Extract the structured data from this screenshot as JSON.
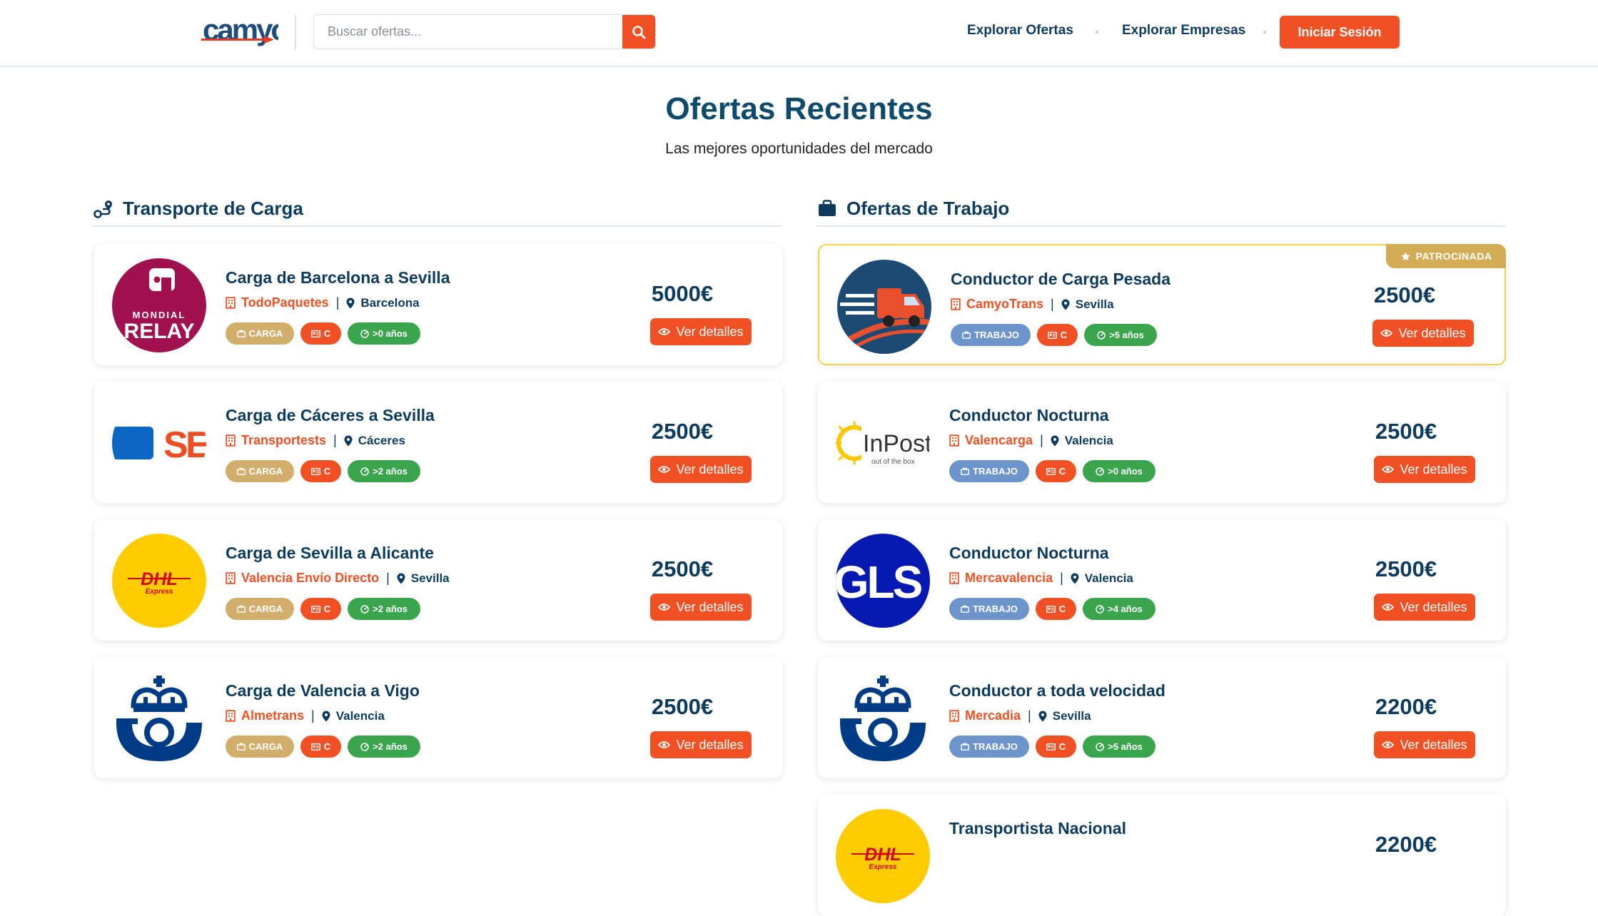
{
  "header": {
    "logo_text": "camyo",
    "search_placeholder": "Buscar ofertas...",
    "nav": [
      "Explorar Ofertas",
      "Explorar Empresas"
    ],
    "login_label": "Iniciar Sesión"
  },
  "hero": {
    "title": "Ofertas Recientes",
    "subtitle": "Las mejores oportunidades del mercado"
  },
  "cargo": {
    "heading": "Transporte de Carga",
    "details_label": "Ver detalles",
    "items": [
      {
        "title": "Carga de Barcelona a Sevilla",
        "company": "TodoPaquetes",
        "city": "Barcelona",
        "type": "CARGA",
        "license": "C",
        "experience": ">0 años",
        "price": "5000€",
        "logo": "mondial-relay"
      },
      {
        "title": "Carga de Cáceres a Sevilla",
        "company": "Transportests",
        "city": "Cáceres",
        "type": "CARGA",
        "license": "C",
        "experience": ">2 años",
        "price": "2500€",
        "logo": "seur"
      },
      {
        "title": "Carga de Sevilla a Alicante",
        "company": "Valencia Envío Directo",
        "city": "Sevilla",
        "type": "CARGA",
        "license": "C",
        "experience": ">2 años",
        "price": "2500€",
        "logo": "dhl"
      },
      {
        "title": "Carga de Valencia a Vigo",
        "company": "Almetrans",
        "city": "Valencia",
        "type": "CARGA",
        "license": "C",
        "experience": ">2 años",
        "price": "2500€",
        "logo": "correos"
      }
    ]
  },
  "jobs": {
    "heading": "Ofertas de Trabajo",
    "details_label": "Ver detalles",
    "sponsored_label": "PATROCINADA",
    "items": [
      {
        "title": "Conductor de Carga Pesada",
        "company": "CamyoTrans",
        "city": "Sevilla",
        "type": "TRABAJO",
        "license": "C",
        "experience": ">5 años",
        "price": "2500€",
        "logo": "truck",
        "sponsored": true
      },
      {
        "title": "Conductor Nocturna",
        "company": "Valencarga",
        "city": "Valencia",
        "type": "TRABAJO",
        "license": "C",
        "experience": ">0 años",
        "price": "2500€",
        "logo": "inpost"
      },
      {
        "title": "Conductor Nocturna",
        "company": "Mercavalencia",
        "city": "Valencia",
        "type": "TRABAJO",
        "license": "C",
        "experience": ">4 años",
        "price": "2500€",
        "logo": "gls"
      },
      {
        "title": "Conductor a toda velocidad",
        "company": "Mercadia",
        "city": "Sevilla",
        "type": "TRABAJO",
        "license": "C",
        "experience": ">5 años",
        "price": "2200€",
        "logo": "correos"
      },
      {
        "title": "Transportista Nacional",
        "company": "",
        "city": "",
        "type": "",
        "license": "",
        "experience": "",
        "price": "2200€",
        "logo": "dhl"
      }
    ]
  },
  "colors": {
    "accent": "#f05023",
    "navy": "#0d3b5e",
    "carga": "#d2ae6c",
    "trabajo": "#6e95cb",
    "experience": "#3aa54c",
    "sponsor": "#d3ad55"
  }
}
